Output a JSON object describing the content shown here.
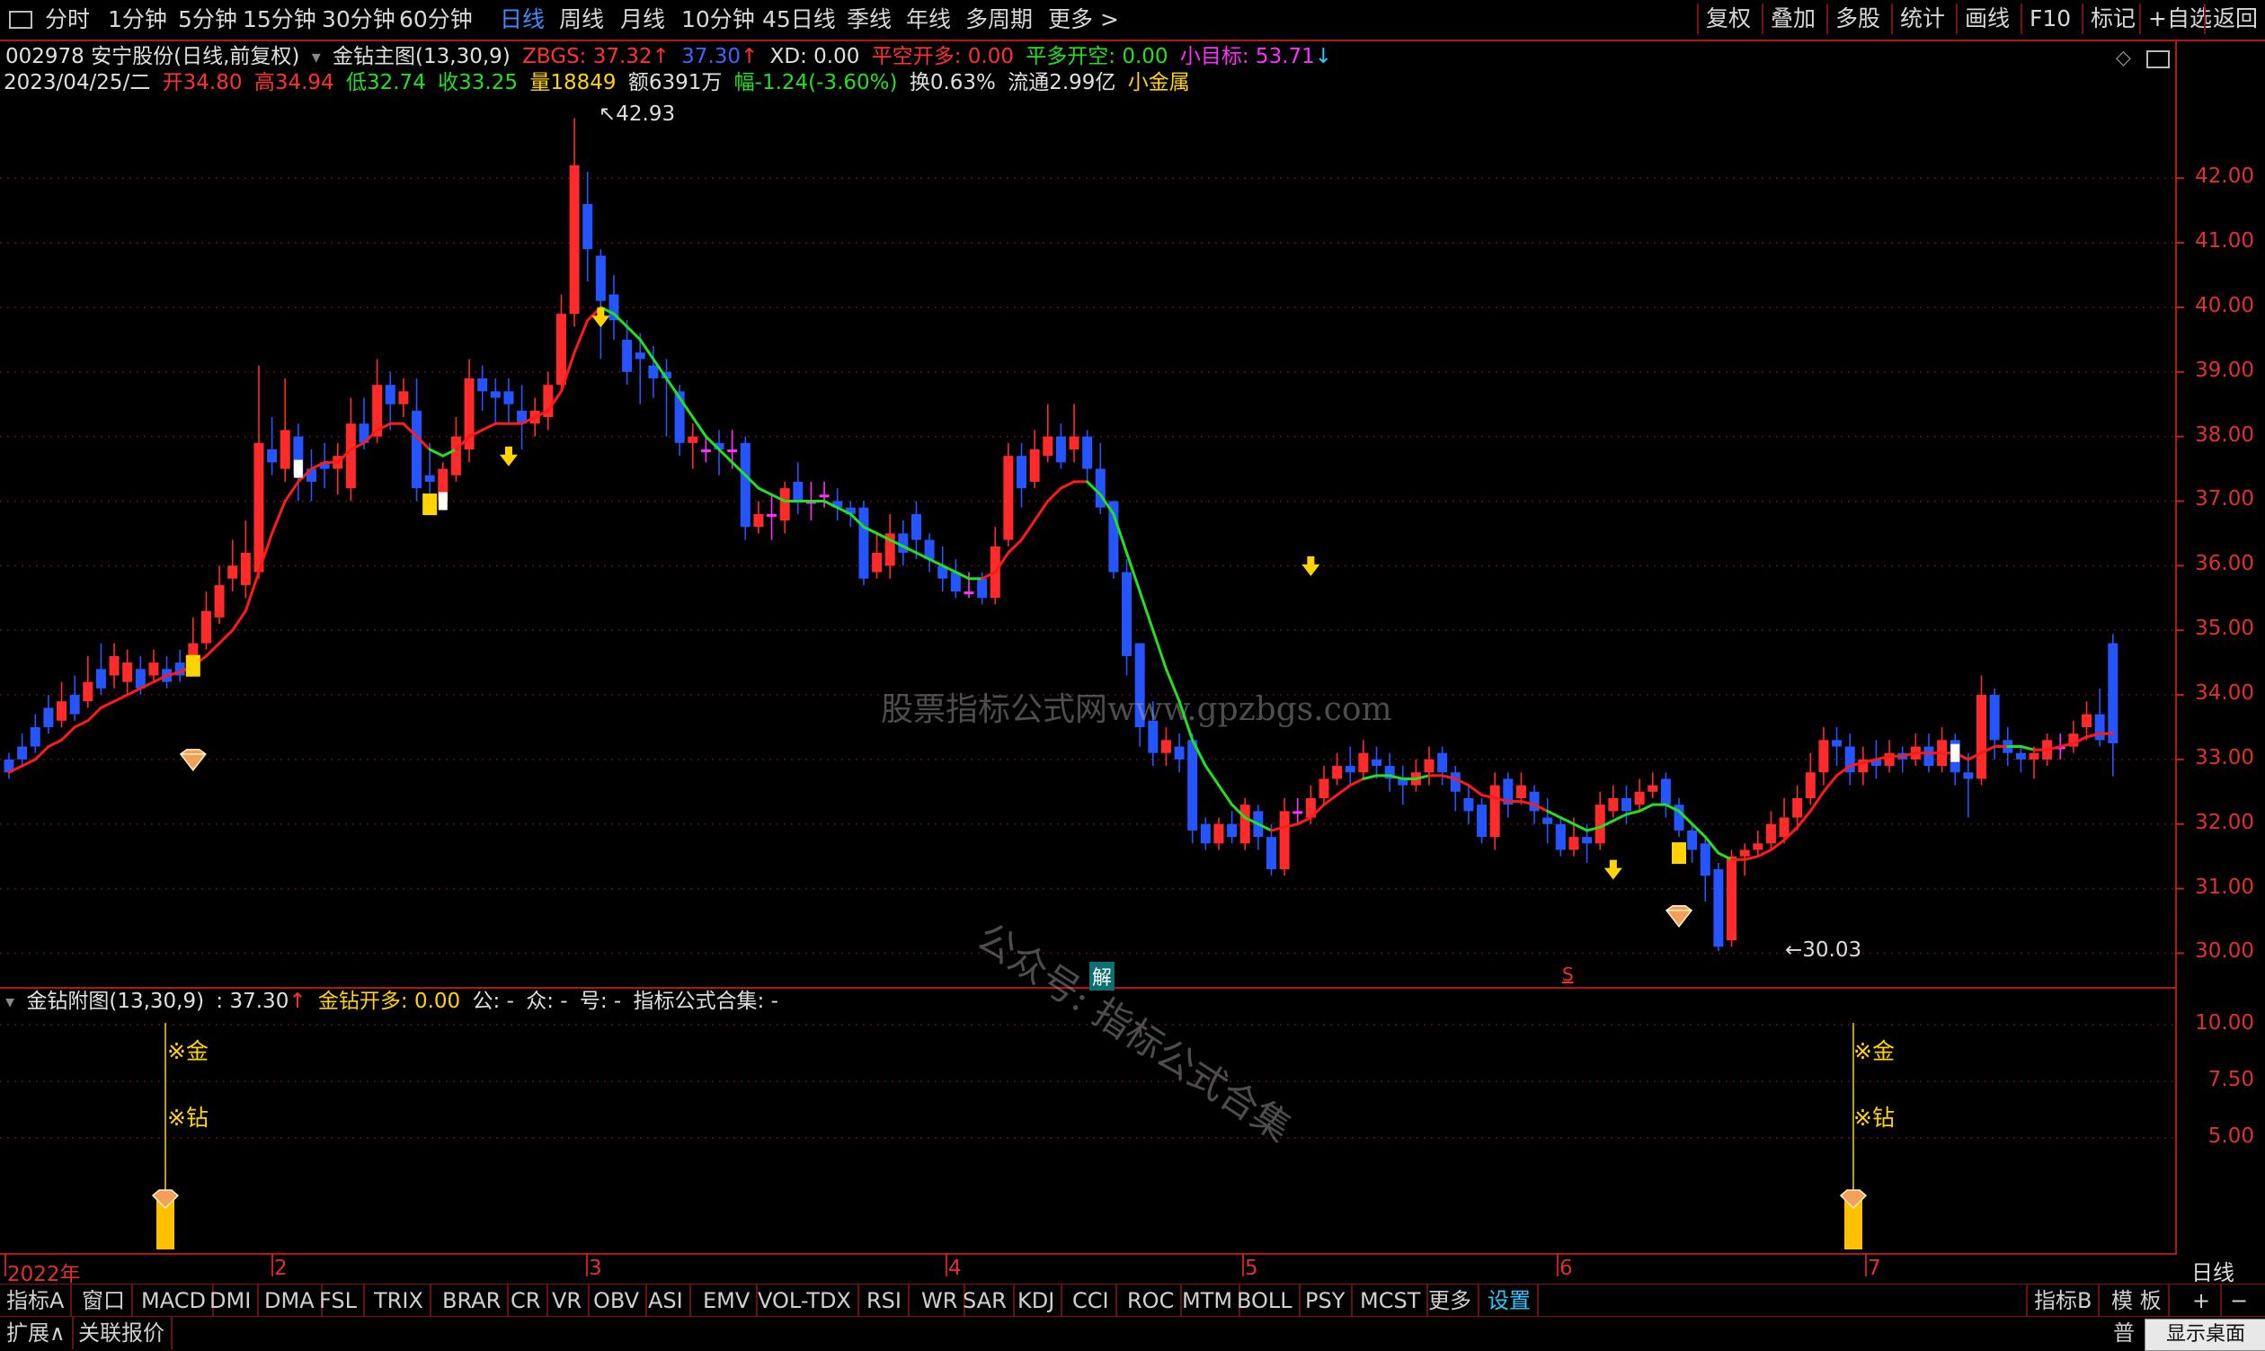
{
  "topbar": {
    "periods": [
      "分时",
      "1分钟",
      "5分钟",
      "15分钟",
      "30分钟",
      "60分钟",
      "日线",
      "周线",
      "月线",
      "10分钟",
      "45日线",
      "季线",
      "年线",
      "多周期",
      "更多 >"
    ],
    "active_period": "日线",
    "tools": [
      "复权",
      "叠加",
      "多股",
      "统计",
      "画线",
      "F10",
      "标记",
      "+自选",
      "返回"
    ]
  },
  "main_header": {
    "stock": "002978 安宁股份(日线,前复权)",
    "indicator": "金钻主图(13,30,9)",
    "zbgs": "ZBGS: 37.32",
    "val2": "37.30",
    "xd": "XD: 0.00",
    "pkkd": "平空开多: 0.00",
    "pdkk": "平多开空: 0.00",
    "target": "小目标: 53.71"
  },
  "quote": {
    "date": "2023/04/25/二",
    "open": "开34.80",
    "high": "高34.94",
    "low": "低32.74",
    "close": "收33.25",
    "vol": "量18849",
    "amount": "额6391万",
    "change": "幅-1.24(-3.60%)",
    "turnover": "换0.63%",
    "float": "流通2.99亿",
    "sector": "小金属"
  },
  "sub_header": {
    "name": "金钻附图(13,30,9)",
    "value": ": 37.30",
    "signal": "金钻开多: 0.00",
    "gong": "公: -",
    "zhong": "众: -",
    "hao": "号: -",
    "set": "指标公式合集: -"
  },
  "marks": {
    "high_label": "42.93",
    "low_label": "30.03",
    "jie": "解",
    "s": "S",
    "jin": "※金",
    "zuan": "※钻"
  },
  "watermarks": {
    "site": "股票指标公式网www.gpzbgs.com",
    "wechat": "公众号: 指标公式合集"
  },
  "colors": {
    "up": "#ff2a2a",
    "down": "#2455ff",
    "cross": "#ff30ff",
    "ma_up": "#ff1a1a",
    "ma_down": "#22e022",
    "grid": "#6a0f0f",
    "signal": "#ffd400"
  },
  "chart_data": {
    "type": "candlestick",
    "price_axis": [
      "42.00",
      "41.00",
      "40.00",
      "39.00",
      "38.00",
      "37.00",
      "36.00",
      "35.00",
      "34.00",
      "33.00",
      "32.00",
      "31.00",
      "30.00"
    ],
    "sub_axis": [
      "10.00",
      "7.50",
      "5.00"
    ],
    "months": [
      "2022年",
      "2",
      "3",
      "4",
      "5",
      "6",
      "7"
    ],
    "ylim": [
      29.7,
      43.2
    ],
    "candles": [
      [
        33.0,
        32.8,
        33.1,
        32.7
      ],
      [
        33.2,
        33.0,
        33.4,
        32.9
      ],
      [
        33.5,
        33.2,
        33.7,
        33.1
      ],
      [
        33.8,
        33.5,
        34.0,
        33.4
      ],
      [
        33.6,
        33.9,
        34.2,
        33.5
      ],
      [
        34.0,
        33.7,
        34.3,
        33.6
      ],
      [
        33.9,
        34.2,
        34.6,
        33.8
      ],
      [
        34.4,
        34.1,
        34.8,
        34.0
      ],
      [
        34.3,
        34.6,
        34.8,
        34.1
      ],
      [
        34.2,
        34.5,
        34.7,
        34.0
      ],
      [
        34.4,
        34.1,
        34.6,
        34.0
      ],
      [
        34.3,
        34.5,
        34.7,
        34.2
      ],
      [
        34.4,
        34.2,
        34.6,
        34.1
      ],
      [
        34.5,
        34.3,
        34.7,
        34.2
      ],
      [
        34.3,
        34.8,
        35.2,
        34.3
      ],
      [
        34.8,
        35.3,
        35.6,
        34.7
      ],
      [
        35.2,
        35.7,
        36.0,
        35.1
      ],
      [
        35.8,
        36.0,
        36.4,
        35.6
      ],
      [
        35.7,
        36.2,
        36.7,
        35.5
      ],
      [
        35.9,
        37.9,
        39.1,
        35.8
      ],
      [
        37.8,
        37.6,
        38.3,
        37.4
      ],
      [
        37.5,
        38.1,
        38.9,
        37.3
      ],
      [
        38.0,
        37.4,
        38.2,
        37.0
      ],
      [
        37.5,
        37.3,
        37.8,
        37.0
      ],
      [
        37.6,
        37.5,
        37.9,
        37.2
      ],
      [
        37.5,
        37.7,
        37.9,
        37.1
      ],
      [
        37.2,
        38.2,
        38.6,
        37.0
      ],
      [
        38.2,
        37.9,
        38.6,
        37.8
      ],
      [
        38.0,
        38.8,
        39.2,
        37.9
      ],
      [
        38.8,
        38.5,
        39.0,
        38.1
      ],
      [
        38.5,
        38.7,
        38.9,
        38.3
      ],
      [
        38.4,
        37.2,
        38.9,
        37.0
      ],
      [
        37.4,
        37.3,
        37.9,
        37.0
      ],
      [
        37.0,
        37.5,
        37.6,
        36.9
      ],
      [
        37.4,
        38.0,
        38.3,
        37.3
      ],
      [
        37.8,
        38.9,
        39.2,
        37.6
      ],
      [
        38.9,
        38.7,
        39.1,
        38.4
      ],
      [
        38.7,
        38.6,
        38.9,
        38.2
      ],
      [
        38.7,
        38.5,
        38.9,
        38.2
      ],
      [
        38.4,
        38.2,
        38.8,
        37.8
      ],
      [
        38.2,
        38.4,
        38.6,
        38.0
      ],
      [
        38.3,
        38.8,
        39.0,
        38.1
      ],
      [
        38.8,
        39.9,
        40.2,
        38.7
      ],
      [
        39.9,
        42.2,
        42.93,
        39.7
      ],
      [
        41.6,
        40.9,
        42.1,
        40.4
      ],
      [
        40.8,
        40.1,
        40.9,
        39.2
      ],
      [
        40.2,
        39.8,
        40.5,
        39.5
      ],
      [
        39.5,
        39.0,
        39.8,
        38.8
      ],
      [
        39.3,
        39.2,
        39.6,
        38.5
      ],
      [
        39.1,
        38.9,
        39.4,
        38.6
      ],
      [
        39.0,
        38.9,
        39.2,
        38.0
      ],
      [
        38.7,
        37.9,
        38.8,
        37.7
      ],
      [
        37.9,
        38.0,
        38.2,
        37.5
      ],
      [
        37.8,
        37.8,
        38.0,
        37.6
      ],
      [
        37.9,
        37.8,
        38.1,
        37.4
      ],
      [
        37.8,
        37.8,
        38.1,
        37.5
      ],
      [
        37.9,
        36.6,
        38.0,
        36.4
      ],
      [
        36.6,
        36.8,
        37.0,
        36.5
      ],
      [
        36.8,
        36.8,
        37.1,
        36.4
      ],
      [
        36.7,
        37.2,
        37.3,
        36.5
      ],
      [
        37.3,
        37.0,
        37.6,
        36.8
      ],
      [
        37.0,
        37.0,
        37.3,
        36.7
      ],
      [
        37.1,
        37.1,
        37.3,
        36.9
      ],
      [
        37.0,
        36.9,
        37.2,
        36.7
      ],
      [
        36.9,
        36.8,
        37.0,
        36.6
      ],
      [
        36.9,
        35.8,
        37.0,
        35.7
      ],
      [
        35.9,
        36.2,
        36.5,
        35.8
      ],
      [
        36.0,
        36.5,
        36.8,
        35.8
      ],
      [
        36.5,
        36.2,
        36.7,
        36.0
      ],
      [
        36.8,
        36.4,
        37.0,
        36.1
      ],
      [
        36.4,
        36.1,
        36.5,
        35.9
      ],
      [
        36.0,
        35.8,
        36.3,
        35.6
      ],
      [
        35.9,
        35.6,
        36.1,
        35.5
      ],
      [
        35.6,
        35.6,
        35.9,
        35.5
      ],
      [
        35.8,
        35.5,
        35.9,
        35.4
      ],
      [
        35.5,
        36.3,
        36.6,
        35.4
      ],
      [
        36.4,
        37.7,
        37.9,
        36.3
      ],
      [
        37.7,
        37.2,
        37.9,
        36.9
      ],
      [
        37.3,
        37.8,
        38.1,
        37.2
      ],
      [
        37.7,
        38.0,
        38.5,
        37.6
      ],
      [
        38.0,
        37.6,
        38.2,
        37.5
      ],
      [
        37.8,
        38.0,
        38.5,
        37.6
      ],
      [
        38.0,
        37.5,
        38.1,
        37.3
      ],
      [
        37.5,
        36.9,
        37.9,
        36.8
      ],
      [
        37.0,
        35.9,
        37.0,
        35.8
      ],
      [
        35.9,
        34.6,
        36.1,
        34.3
      ],
      [
        34.8,
        33.5,
        34.8,
        33.2
      ],
      [
        33.6,
        33.1,
        33.9,
        32.9
      ],
      [
        33.1,
        33.3,
        33.5,
        32.9
      ],
      [
        33.2,
        33.0,
        33.4,
        32.8
      ],
      [
        33.3,
        31.9,
        33.4,
        31.7
      ],
      [
        32.0,
        31.7,
        32.1,
        31.6
      ],
      [
        31.7,
        32.0,
        32.1,
        31.6
      ],
      [
        32.0,
        31.8,
        32.2,
        31.7
      ],
      [
        31.7,
        32.3,
        32.4,
        31.6
      ],
      [
        32.2,
        31.8,
        32.3,
        31.6
      ],
      [
        31.8,
        31.3,
        32.0,
        31.2
      ],
      [
        31.3,
        32.2,
        32.4,
        31.2
      ],
      [
        32.2,
        32.2,
        32.4,
        32.0
      ],
      [
        32.1,
        32.4,
        32.6,
        32.0
      ],
      [
        32.4,
        32.7,
        32.9,
        32.3
      ],
      [
        32.7,
        32.9,
        33.1,
        32.6
      ],
      [
        32.9,
        32.8,
        33.2,
        32.6
      ],
      [
        32.8,
        33.1,
        33.3,
        32.7
      ],
      [
        33.0,
        32.9,
        33.2,
        32.7
      ],
      [
        32.9,
        32.7,
        33.1,
        32.5
      ],
      [
        32.7,
        32.6,
        32.9,
        32.3
      ],
      [
        32.6,
        32.8,
        33.0,
        32.5
      ],
      [
        32.8,
        33.0,
        33.2,
        32.6
      ],
      [
        33.1,
        32.8,
        33.2,
        32.6
      ],
      [
        32.8,
        32.5,
        32.9,
        32.2
      ],
      [
        32.4,
        32.2,
        32.6,
        32.0
      ],
      [
        32.3,
        31.8,
        32.4,
        31.7
      ],
      [
        31.8,
        32.6,
        32.8,
        31.6
      ],
      [
        32.7,
        32.3,
        32.8,
        32.1
      ],
      [
        32.4,
        32.6,
        32.8,
        32.3
      ],
      [
        32.5,
        32.2,
        32.6,
        32.0
      ],
      [
        32.1,
        32.0,
        32.4,
        31.7
      ],
      [
        32.0,
        31.6,
        32.1,
        31.5
      ],
      [
        31.6,
        31.8,
        32.1,
        31.5
      ],
      [
        31.8,
        31.7,
        32.0,
        31.4
      ],
      [
        31.7,
        32.3,
        32.5,
        31.6
      ],
      [
        32.2,
        32.4,
        32.6,
        32.1
      ],
      [
        32.4,
        32.2,
        32.6,
        32.0
      ],
      [
        32.3,
        32.5,
        32.7,
        32.2
      ],
      [
        32.5,
        32.6,
        32.8,
        32.4
      ],
      [
        32.7,
        32.3,
        32.8,
        32.1
      ],
      [
        32.3,
        31.9,
        32.4,
        31.8
      ],
      [
        31.9,
        31.6,
        32.0,
        31.4
      ],
      [
        31.7,
        31.2,
        31.8,
        30.8
      ],
      [
        31.3,
        30.1,
        31.4,
        30.03
      ],
      [
        30.2,
        31.5,
        31.6,
        30.1
      ],
      [
        31.5,
        31.6,
        31.7,
        31.2
      ],
      [
        31.6,
        31.7,
        31.9,
        31.5
      ],
      [
        31.7,
        32.0,
        32.2,
        31.6
      ],
      [
        31.8,
        32.1,
        32.4,
        31.7
      ],
      [
        32.1,
        32.4,
        32.6,
        31.9
      ],
      [
        32.4,
        32.8,
        33.1,
        32.3
      ],
      [
        32.8,
        33.3,
        33.5,
        32.6
      ],
      [
        33.3,
        33.2,
        33.5,
        32.9
      ],
      [
        33.2,
        32.8,
        33.4,
        32.6
      ],
      [
        32.8,
        33.0,
        33.2,
        32.6
      ],
      [
        33.0,
        32.9,
        33.3,
        32.7
      ],
      [
        32.9,
        33.1,
        33.3,
        32.8
      ],
      [
        33.1,
        33.0,
        33.2,
        32.8
      ],
      [
        33.0,
        33.2,
        33.4,
        32.9
      ],
      [
        33.2,
        32.9,
        33.4,
        32.8
      ],
      [
        32.9,
        33.3,
        33.5,
        32.8
      ],
      [
        33.3,
        32.8,
        33.4,
        32.6
      ],
      [
        32.8,
        32.7,
        33.1,
        32.1
      ],
      [
        32.7,
        34.0,
        34.3,
        32.6
      ],
      [
        34.0,
        33.3,
        34.1,
        33.0
      ],
      [
        33.3,
        33.1,
        33.5,
        32.9
      ],
      [
        33.1,
        33.0,
        33.2,
        32.8
      ],
      [
        33.0,
        33.1,
        33.2,
        32.7
      ],
      [
        33.0,
        33.3,
        33.4,
        32.9
      ],
      [
        33.2,
        33.2,
        33.4,
        33.0
      ],
      [
        33.2,
        33.4,
        33.6,
        33.1
      ],
      [
        33.5,
        33.7,
        33.9,
        33.3
      ],
      [
        33.7,
        33.3,
        34.1,
        33.2
      ],
      [
        34.8,
        33.25,
        34.94,
        32.74
      ]
    ],
    "ma": [
      32.8,
      32.9,
      33.0,
      33.2,
      33.3,
      33.5,
      33.6,
      33.8,
      33.9,
      34.0,
      34.1,
      34.2,
      34.3,
      34.35,
      34.45,
      34.6,
      34.8,
      35.0,
      35.3,
      35.9,
      36.5,
      37.0,
      37.3,
      37.5,
      37.6,
      37.6,
      37.8,
      37.9,
      38.1,
      38.2,
      38.2,
      38.0,
      37.8,
      37.7,
      37.8,
      38.0,
      38.1,
      38.2,
      38.2,
      38.2,
      38.3,
      38.4,
      38.7,
      39.3,
      39.8,
      40.0,
      39.9,
      39.7,
      39.5,
      39.2,
      38.9,
      38.6,
      38.3,
      38.0,
      37.8,
      37.6,
      37.4,
      37.2,
      37.1,
      37.0,
      37.0,
      37.0,
      37.0,
      36.9,
      36.8,
      36.6,
      36.5,
      36.4,
      36.3,
      36.2,
      36.1,
      36.0,
      35.9,
      35.8,
      35.8,
      35.9,
      36.2,
      36.4,
      36.7,
      37.0,
      37.2,
      37.3,
      37.3,
      37.1,
      36.8,
      36.2,
      35.6,
      35.0,
      34.4,
      33.9,
      33.3,
      32.9,
      32.6,
      32.3,
      32.1,
      32.0,
      31.9,
      31.95,
      32.0,
      32.1,
      32.3,
      32.45,
      32.6,
      32.7,
      32.75,
      32.75,
      32.7,
      32.7,
      32.75,
      32.75,
      32.7,
      32.6,
      32.45,
      32.4,
      32.35,
      32.35,
      32.3,
      32.2,
      32.1,
      32.0,
      31.9,
      31.95,
      32.05,
      32.15,
      32.2,
      32.3,
      32.3,
      32.2,
      32.0,
      31.8,
      31.55,
      31.45,
      31.45,
      31.5,
      31.6,
      31.75,
      31.95,
      32.2,
      32.5,
      32.75,
      32.9,
      32.95,
      33.0,
      33.05,
      33.05,
      33.1,
      33.1,
      33.1,
      33.1,
      33.0,
      33.1,
      33.2,
      33.2,
      33.2,
      33.15,
      33.15,
      33.2,
      33.25,
      33.35,
      33.4,
      33.4
    ],
    "ma_green_ranges": [
      [
        32,
        34
      ],
      [
        45,
        74
      ],
      [
        82,
        96
      ],
      [
        103,
        108
      ],
      [
        117,
        131
      ],
      [
        152,
        154
      ]
    ],
    "arrows_down": [
      [
        38,
        37.65
      ],
      [
        45,
        39.8
      ],
      [
        99,
        35.95
      ],
      [
        122,
        31.25
      ]
    ],
    "yellow_squares": [
      [
        14,
        34.45
      ],
      [
        32,
        36.95
      ],
      [
        127,
        31.55
      ]
    ],
    "white_squares": [
      [
        33,
        37.0
      ],
      [
        22,
        37.5
      ],
      [
        148,
        33.1
      ]
    ],
    "diamonds": [
      [
        14,
        33.0
      ],
      [
        127,
        30.58
      ]
    ],
    "sub_signal_bars": [
      14,
      127
    ],
    "jie_x": 93,
    "s_x": 134
  }
}
